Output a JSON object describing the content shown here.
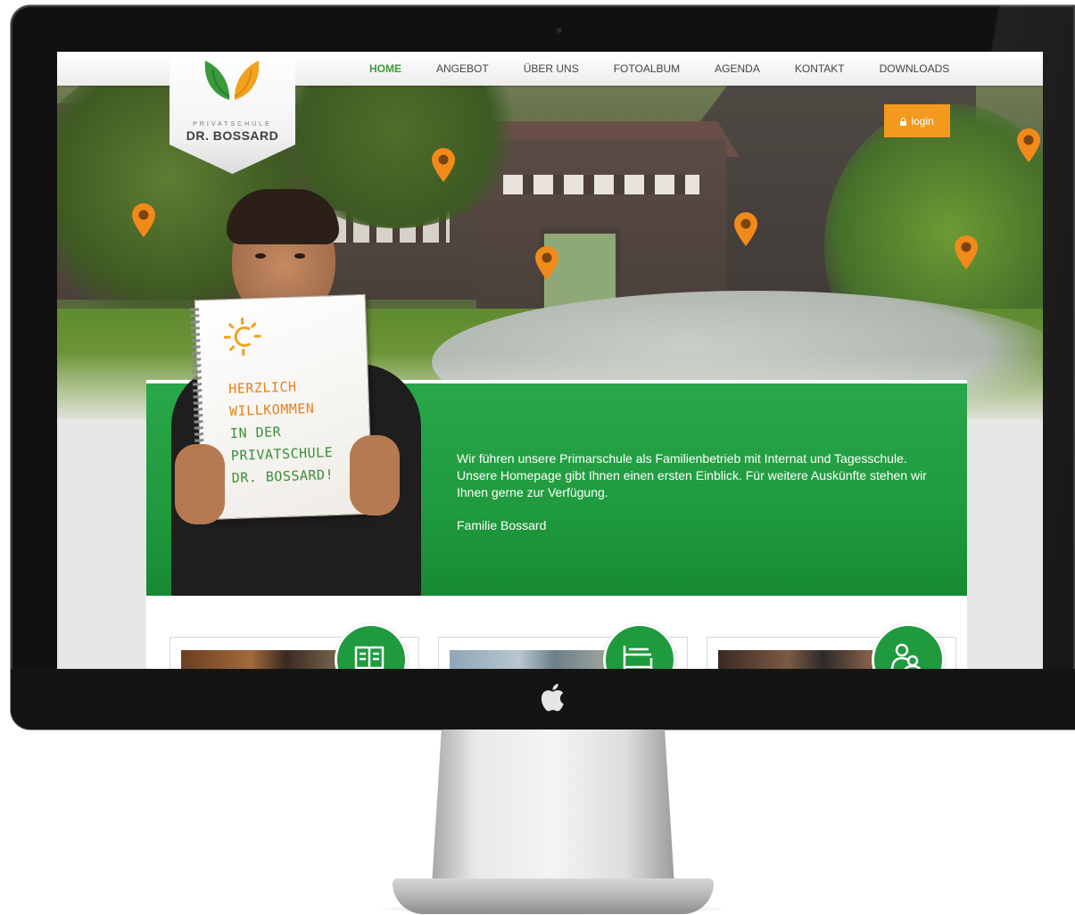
{
  "colors": {
    "accent_green": "#1f9a3e",
    "nav_active": "#3e9b3a",
    "login_orange": "#f39a1e",
    "pin_orange": "#f28a1a"
  },
  "logo": {
    "subtitle": "PRIVATSCHULE",
    "name": "DR. BOSSARD"
  },
  "nav": {
    "items": [
      {
        "label": "HOME",
        "active": true
      },
      {
        "label": "ANGEBOT"
      },
      {
        "label": "ÜBER UNS"
      },
      {
        "label": "FOTOALBUM"
      },
      {
        "label": "AGENDA"
      },
      {
        "label": "KONTAKT"
      },
      {
        "label": "DOWNLOADS"
      }
    ]
  },
  "login": {
    "label": "login",
    "icon": "lock-icon"
  },
  "hero": {
    "pin_icon": "map-pin-icon",
    "pin_count": 6
  },
  "notebook": {
    "lines": [
      "HERZLICH",
      "WILLKOMMEN",
      "IN DER",
      "PRIVATSCHULE",
      "DR. BOSSARD!"
    ],
    "icon": "sun-icon"
  },
  "welcome": {
    "text": "Wir führen unsere Primarschule als Familienbetrieb mit Internat und Tagesschule. Unsere Homepage gibt Ihnen einen ersten Einblick. Für weitere Auskünfte stehen wir Ihnen gerne zur Verfügung.",
    "signature": "Familie Bossard"
  },
  "cards": [
    {
      "icon": "book-icon"
    },
    {
      "icon": "bed-icon"
    },
    {
      "icon": "people-icon"
    }
  ],
  "device": {
    "logo_icon": "apple-logo-icon"
  }
}
